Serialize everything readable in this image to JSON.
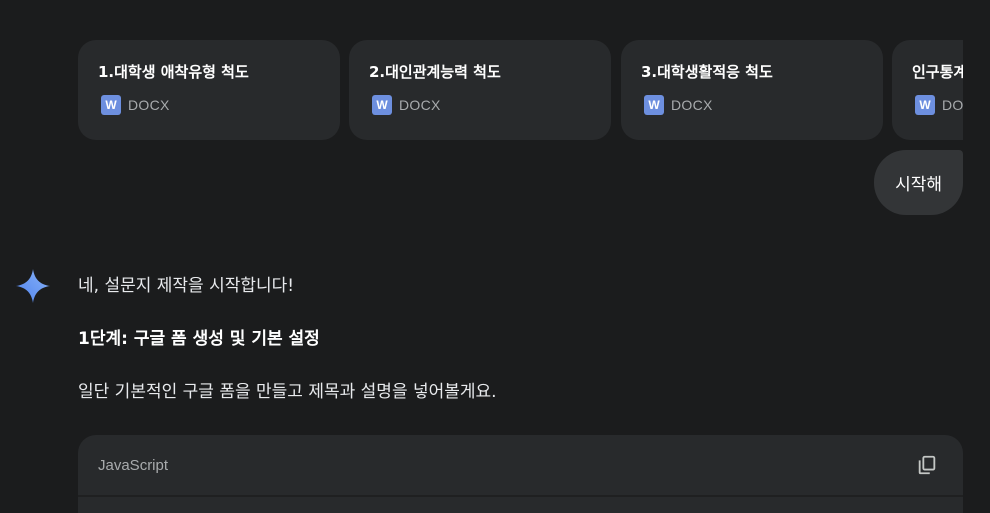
{
  "attachments": [
    {
      "name": "1.대학생 애착유형 척도",
      "type": "DOCX",
      "icon": "word-doc-icon"
    },
    {
      "name": "2.대인관계능력 척도",
      "type": "DOCX",
      "icon": "word-doc-icon"
    },
    {
      "name": "3.대학생활적응 척도",
      "type": "DOCX",
      "icon": "word-doc-icon"
    },
    {
      "name": "인구통계",
      "type": "DOCX",
      "icon": "word-doc-icon"
    }
  ],
  "word_icon_letter": "W",
  "user_message": "시작해",
  "response": {
    "intro": "네, 설문지 제작을 시작합니다!",
    "heading": "1단계: 구글 폼 생성 및 기본 설정",
    "paragraph": "일단 기본적인 구글 폼을 만들고 제목과 설명을 넣어볼게요."
  },
  "code_block": {
    "language": "JavaScript",
    "copy_icon": "copy-icon"
  },
  "colors": {
    "background": "#1b1c1d",
    "card": "#282a2c",
    "user_bubble": "#333537",
    "word_icon": "#6d8fdf",
    "gemini_gradient_start": "#4e82ee",
    "gemini_gradient_end": "#8ab4f8"
  }
}
